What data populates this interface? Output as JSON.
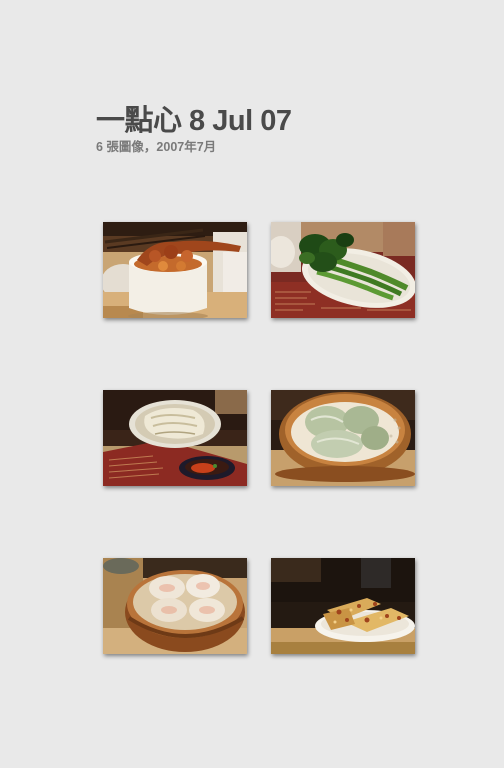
{
  "album": {
    "title": "一點心 8 Jul 07",
    "subtitle": "6 張圖像，2007年7月"
  },
  "photos": [
    {
      "icon": "fried-chicken-feet-bowl-photo"
    },
    {
      "icon": "gai-lan-vegetable-plate-photo"
    },
    {
      "icon": "rice-noodle-roll-plate-photo"
    },
    {
      "icon": "steamed-dumplings-basket-photo"
    },
    {
      "icon": "har-gow-shrimp-dumplings-basket-photo"
    },
    {
      "icon": "turnip-cake-plate-photo"
    }
  ]
}
